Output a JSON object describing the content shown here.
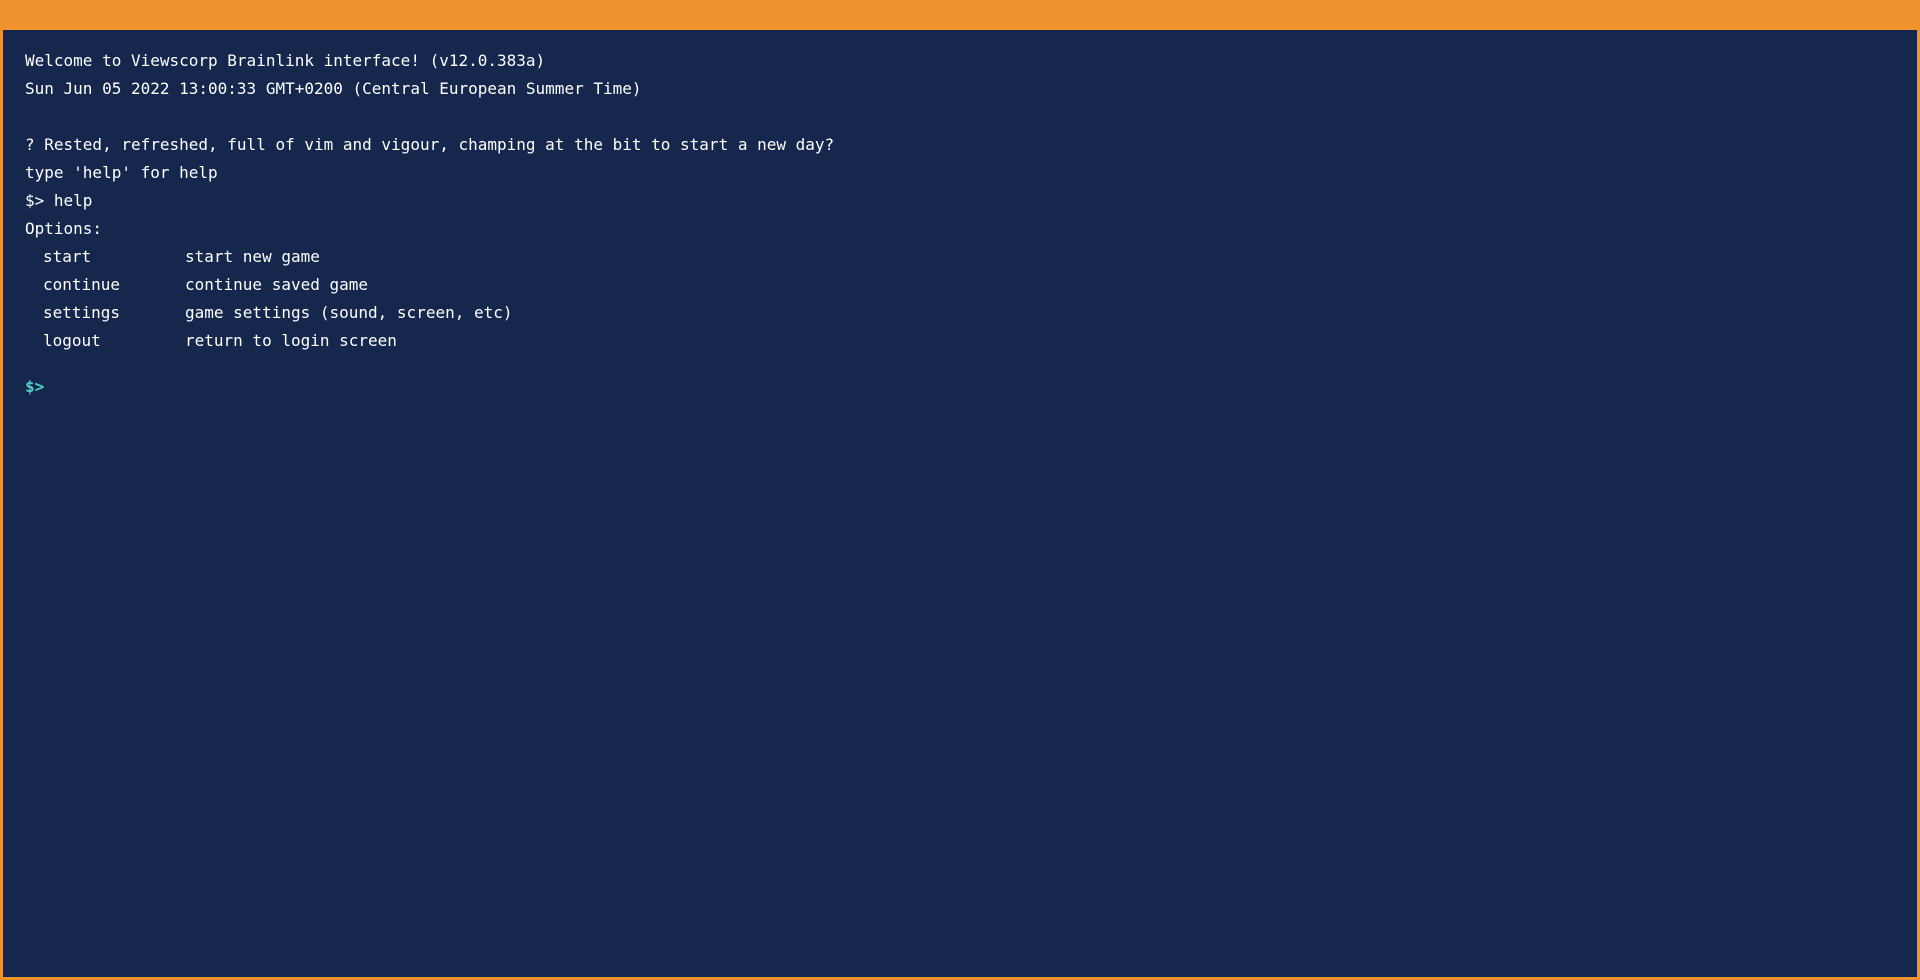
{
  "terminal": {
    "welcome": "Welcome to Viewscorp Brainlink interface! (v12.0.383a)",
    "datetime": "Sun Jun 05 2022 13:00:33 GMT+0200 (Central European Summer Time)",
    "question": "? Rested, refreshed, full of vim and vigour, champing at the bit to start a new day?",
    "hint": "type 'help' for help",
    "history_command": "$> help",
    "options_header": "Options:",
    "options": [
      {
        "cmd": "start",
        "desc": "start new game"
      },
      {
        "cmd": "continue",
        "desc": "continue saved game"
      },
      {
        "cmd": "settings",
        "desc": "game settings (sound, screen, etc)"
      },
      {
        "cmd": "logout",
        "desc": "return to login screen"
      }
    ],
    "prompt": "$>",
    "input_value": ""
  },
  "colors": {
    "frame": "#f0922e",
    "background": "#15274d",
    "text": "#ffffff",
    "prompt": "#4fd1c5"
  }
}
